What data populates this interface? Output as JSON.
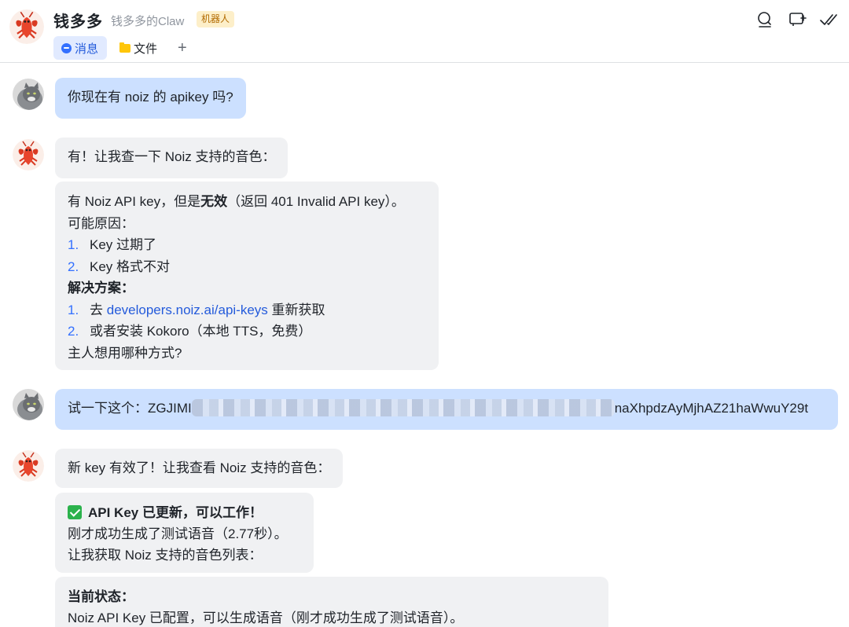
{
  "header": {
    "title": "钱多多",
    "subtitle": "钱多多的Claw",
    "badge": "机器人",
    "tabs": {
      "messages": "消息",
      "files": "文件",
      "add": "+"
    }
  },
  "messages": [
    {
      "from": "user",
      "text": "你现在有 noiz 的 apikey 吗?"
    },
    {
      "from": "bot",
      "text": "有！让我查一下 Noiz 支持的音色："
    },
    {
      "from": "bot",
      "l1_pre": "有 Noiz API key，但是",
      "l1_bold": "无效",
      "l1_post": "（返回 401 Invalid API key）。",
      "l2": "可能原因：",
      "reasons": [
        {
          "n": "1.",
          "t": "Key 过期了"
        },
        {
          "n": "2.",
          "t": "Key 格式不对"
        }
      ],
      "solutions_title": "解决方案：",
      "s1_n": "1.",
      "s1_pre": "去 ",
      "s1_link": "developers.noiz.ai/api-keys",
      "s1_post": " 重新获取",
      "s2_n": "2.",
      "s2": "或者安装 Kokoro（本地 TTS，免费）",
      "question": "主人想用哪种方式?"
    },
    {
      "from": "user",
      "prefix": "试一下这个：ZGJIMI",
      "suffix": "naXhpdzAyMjhAZ21haWwuY29t"
    },
    {
      "from": "bot",
      "text": "新 key 有效了！让我查看 Noiz 支持的音色："
    },
    {
      "from": "bot",
      "title": "API Key 已更新，可以工作！",
      "line2": "刚才成功生成了测试语音（2.77秒）。",
      "line3": "让我获取 Noiz 支持的音色列表："
    },
    {
      "from": "bot",
      "title": "当前状态：",
      "line2": "Noiz API Key 已配置，可以生成语音（刚才成功生成了测试语音）。"
    }
  ],
  "icons": [
    "lobster-avatar",
    "cat-avatar",
    "search-icon",
    "add-chat-icon",
    "done-check-icon",
    "checkmark-emoji-icon"
  ],
  "colors": {
    "accent": "#3370ff",
    "user_bubble": "#cce0ff",
    "bot_bubble": "#f0f1f3",
    "badge_bg": "#fdefc9"
  }
}
